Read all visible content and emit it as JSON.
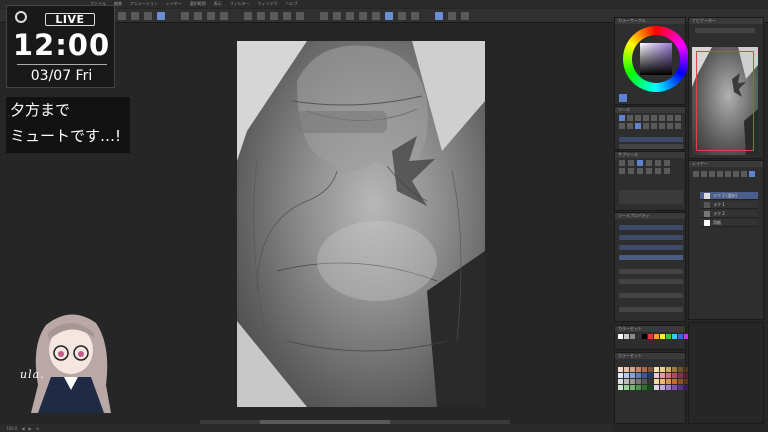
{
  "overlay": {
    "live_label": "LIVE",
    "time": "12:00",
    "date": "03/07 Fri",
    "mute_line1": "夕方まで",
    "mute_line2": "ミュートです…!",
    "signature": "ula."
  },
  "colors": {
    "app_bg": "#262626",
    "panel_bg": "#2e2e2e",
    "accent": "#5d84d0",
    "overlay_bg": "#121212",
    "text": "#ffffff"
  },
  "icons": {
    "live_dot": "record-icon",
    "color_wheel": "color-wheel-icon",
    "brush": "brush-icon"
  },
  "panels": {
    "navigator_title": "ナビゲーター",
    "layer_title": "レイヤー",
    "layers": [
      {
        "name": "ラフ 2 (選択)"
      },
      {
        "name": "ラフ 1"
      },
      {
        "name": "ラフ 2"
      },
      {
        "name": "用紙"
      }
    ]
  }
}
